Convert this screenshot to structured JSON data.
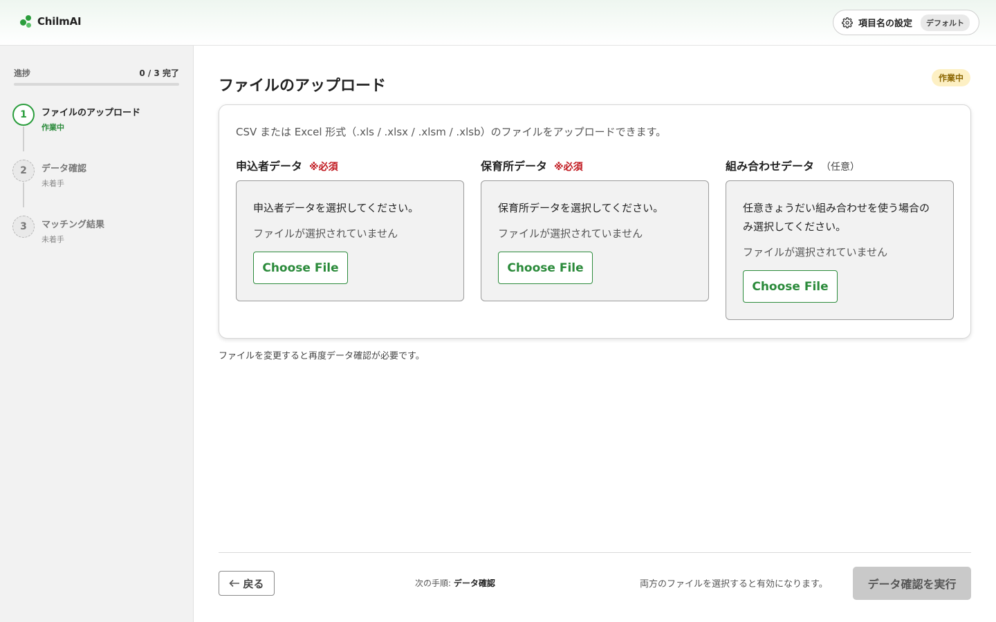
{
  "header": {
    "logo_text": "ChilmAI",
    "settings_label": "項目名の設定",
    "settings_badge": "デフォルト",
    "brand_color": "#2a9d3c"
  },
  "sidebar": {
    "progress_label": "進捗",
    "progress_count": "0 / 3 完了",
    "progress_fraction": 0,
    "steps": [
      {
        "number": "1",
        "title": "ファイルのアップロード",
        "status": "作業中",
        "state": "active"
      },
      {
        "number": "2",
        "title": "データ確認",
        "status": "未着手",
        "state": "todo"
      },
      {
        "number": "3",
        "title": "マッチング結果",
        "status": "未着手",
        "state": "todo"
      }
    ]
  },
  "main": {
    "title": "ファイルのアップロード",
    "status_badge": "作業中",
    "description": "CSV または Excel 形式（.xls / .xlsx / .xlsm / .xlsb）のファイルをアップロードできます。",
    "uploads": [
      {
        "title": "申込者データ",
        "required_label": "※必須",
        "optional_label": "",
        "prompt": "申込者データを選択してください。",
        "file_state": "ファイルが選択されていません",
        "button_label": "Choose File"
      },
      {
        "title": "保育所データ",
        "required_label": "※必須",
        "optional_label": "",
        "prompt": "保育所データを選択してください。",
        "file_state": "ファイルが選択されていません",
        "button_label": "Choose File"
      },
      {
        "title": "組み合わせデータ",
        "required_label": "",
        "optional_label": "（任意）",
        "prompt": "任意きょうだい組み合わせを使う場合のみ選択してください。",
        "file_state": "ファイルが選択されていません",
        "button_label": "Choose File"
      }
    ],
    "note": "ファイルを変更すると再度データ確認が必要です。"
  },
  "footer": {
    "back_label": "戻る",
    "back_icon": "arrow-left-icon",
    "next_step_prefix": "次の手順:",
    "next_step_value": "データ確認",
    "hint": "両方のファイルを選択すると有効になります。",
    "run_label": "データ確認を実行"
  }
}
